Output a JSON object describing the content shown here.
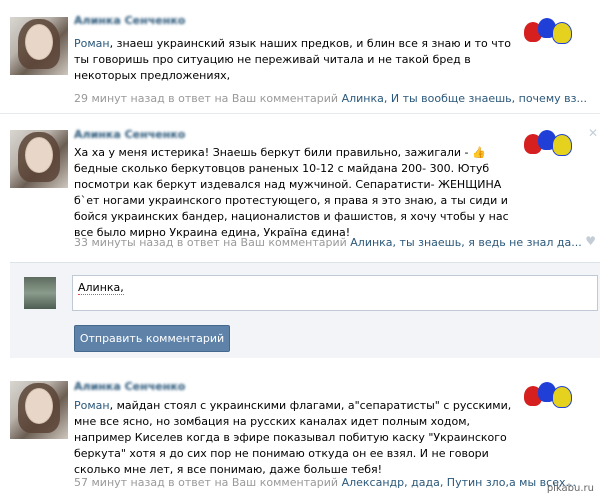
{
  "comments": [
    {
      "author": "Алинка Сенченко",
      "text_who": "Роман",
      "text": ", знаеш украинский язык наших предков, и блин все я знаю и то что ты говоришь про ситуацию не переживай читала и не такой бред в некоторых предложениях,",
      "time": "29 минут назад в ответ на Ваш комментарий",
      "quote": "Алинка, И ты вообще знаешь, почему вз..."
    },
    {
      "author": "Алинка Сенченко",
      "text": "Ха ха у меня истерика! Знаешь беркут били правильно, зажигали - 👍 бедные сколько беркутовцов раненых 10-12 с майдана 200- 300. Ютуб посмотри как беркут издевался над мужчиной. Сепаратисти- ЖЕНЩИНА б`ет ногами украинского протестующего, я права я это знаю, а ты сиди и бойся украинских бандер, националистов и фашистов, я хочу чтобы у нас все было мирно Украина едина, Україна єдина!",
      "time": "33 минуты назад в ответ на Ваш комментарий",
      "quote": "Алинка, ты знаешь, я ведь не знал да..."
    },
    {
      "author": "Алинка Сенченко",
      "text_who": "Роман",
      "text": ", майдан стоял с украинскими флагами, а\"сепаратисты\" с русскими, мне все ясно, но зомбация на русских каналах идет полным ходом, например Киселев когда в эфире показывал побитую каску \"Украинского беркута\" хотя я до сих пор не понимаю откуда он ее взял. И не говори сколько мне лет, я все понимаю, даже больше тебя!",
      "time": "57 минут назад в ответ на Ваш комментарий",
      "quote": "Александр, дада, Путин зло,а мы всех..."
    }
  ],
  "reply": {
    "value": "Алинка,",
    "send_label": "Отправить комментарий"
  },
  "watermark": "pikabu.ru",
  "icons": {
    "close": "✕",
    "like": "♥"
  }
}
